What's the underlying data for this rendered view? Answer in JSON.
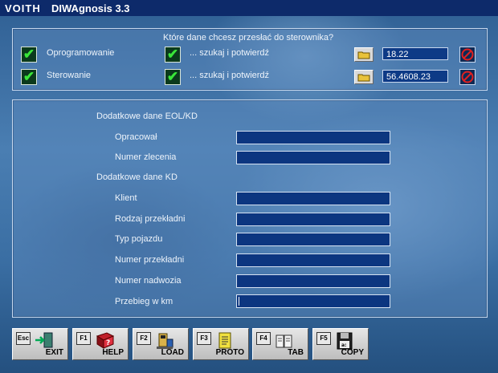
{
  "titlebar": {
    "brand": "VOITH",
    "app_title": "DIWAgnosis 3.3"
  },
  "transfer": {
    "question": "Które dane chcesz przesłać do sterownika?",
    "rows": [
      {
        "label": "Oprogramowanie",
        "search_label": "... szukaj i potwierdź",
        "value": "18.22"
      },
      {
        "label": "Sterowanie",
        "search_label": "... szukaj i potwierdź",
        "value": "56.4608.23"
      }
    ]
  },
  "form": {
    "section_eol": "Dodatkowe dane EOL/KD",
    "section_kd": "Dodatkowe dane KD",
    "fields": {
      "opracowal": {
        "label": "Opracował",
        "value": ""
      },
      "numer_zlecenia": {
        "label": "Numer zlecenia",
        "value": ""
      },
      "klient": {
        "label": "Klient",
        "value": ""
      },
      "rodzaj_przekladni": {
        "label": "Rodzaj przekładni",
        "value": ""
      },
      "typ_pojazdu": {
        "label": "Typ pojazdu",
        "value": ""
      },
      "numer_przekladni": {
        "label": "Numer przekładni",
        "value": ""
      },
      "numer_nadwozia": {
        "label": "Numer nadwozia",
        "value": ""
      },
      "przebieg": {
        "label": "Przebieg w km",
        "value": ""
      }
    }
  },
  "function_keys": [
    {
      "key": "Esc",
      "label": "EXIT",
      "icon": "exit-door-icon"
    },
    {
      "key": "F1",
      "label": "HELP",
      "icon": "help-book-icon"
    },
    {
      "key": "F2",
      "label": "LOAD",
      "icon": "load-device-icon"
    },
    {
      "key": "F3",
      "label": "PROTO",
      "icon": "protocol-document-icon"
    },
    {
      "key": "F4",
      "label": "TAB",
      "icon": "table-book-icon"
    },
    {
      "key": "F5",
      "label": "COPY",
      "icon": "floppy-disk-icon"
    }
  ],
  "colors": {
    "titlebar": "#0d2a6a",
    "field_bg": "#0c3680",
    "check": "#39e639",
    "stop": "#e02020"
  }
}
